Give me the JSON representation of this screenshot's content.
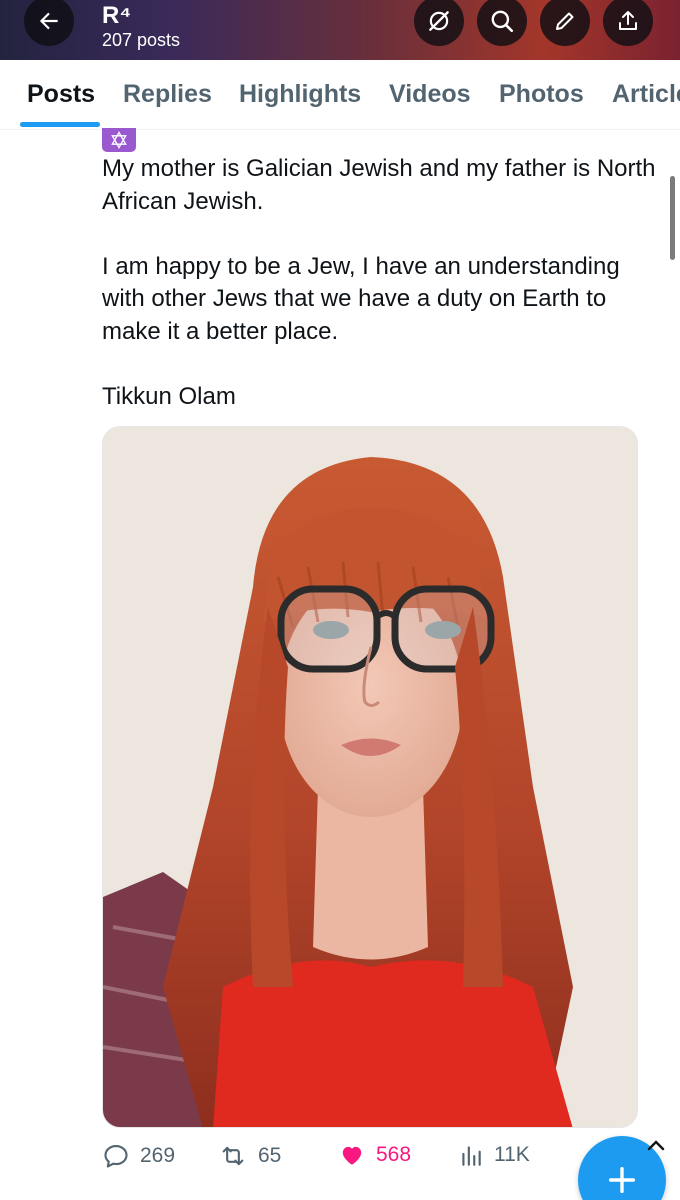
{
  "header": {
    "title": "R⁴",
    "subtitle": "207 posts",
    "gradient_colors": [
      "#23233f",
      "#6a2f3a",
      "#a3362a"
    ],
    "icons": [
      "back-arrow-icon",
      "grok-icon",
      "search-icon",
      "edit-icon",
      "share-icon"
    ]
  },
  "tabs": [
    {
      "label": "Posts",
      "active": true
    },
    {
      "label": "Replies"
    },
    {
      "label": "Highlights"
    },
    {
      "label": "Videos"
    },
    {
      "label": "Photos"
    },
    {
      "label": "Articles"
    }
  ],
  "post": {
    "emoji": "✡",
    "paragraphs": [
      "My mother is Galician Jewish and my father is North African Jewish.",
      "I am happy to be a Jew, I have an understanding with other Jews that we have a duty on Earth to make it a better place.",
      "Tikkun Olam"
    ],
    "actions": {
      "replies": "269",
      "reposts": "65",
      "likes": "568",
      "views": "11K"
    }
  },
  "colors": {
    "accent": "#1d9bf0",
    "like": "#f91880",
    "secondary_text": "#536471"
  },
  "fab": {
    "icon": "plus-icon"
  }
}
